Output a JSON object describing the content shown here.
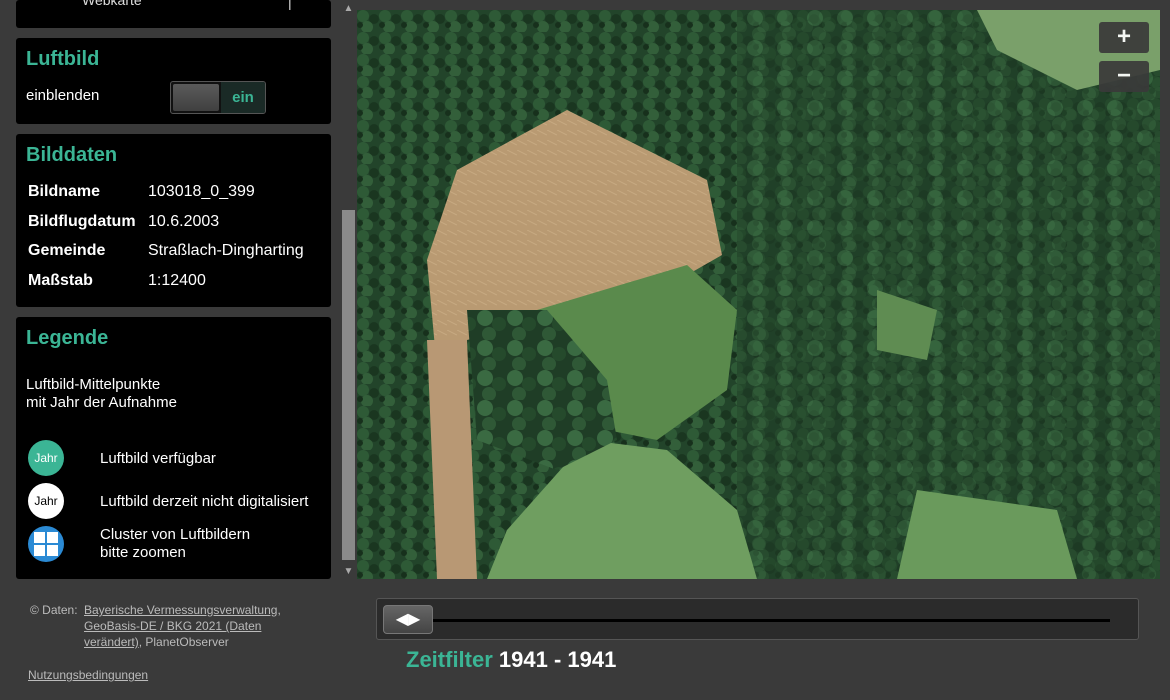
{
  "top_panel": {
    "label": "Webkarte",
    "mark": "|"
  },
  "luftbild": {
    "title": "Luftbild",
    "label": "einblenden",
    "toggle_state": "ein"
  },
  "bilddaten": {
    "title": "Bilddaten",
    "rows": [
      {
        "key": "Bildname",
        "value": "103018_0_399"
      },
      {
        "key": "Bildflugdatum",
        "value": "10.6.2003"
      },
      {
        "key": "Gemeinde",
        "value": "Straßlach-Dingharting"
      },
      {
        "key": "Maßstab",
        "value": "1:12400"
      }
    ]
  },
  "legende": {
    "title": "Legende",
    "intro_line1": "Luftbild-Mittelpunkte",
    "intro_line2": "mit Jahr der Aufnahme",
    "items": [
      {
        "symbol_text": "Jahr",
        "line1": "Luftbild verfügbar",
        "line2": ""
      },
      {
        "symbol_text": "Jahr",
        "line1": "Luftbild derzeit nicht digitalisiert",
        "line2": ""
      },
      {
        "symbol_text": "",
        "line1": "Cluster von Luftbildern",
        "line2": "bitte zoomen"
      }
    ]
  },
  "map": {
    "zoom_in": "+",
    "zoom_out": "−"
  },
  "footer": {
    "prefix": "© Daten:",
    "link1": "Bayerische Vermessungsverwaltung",
    "sep1": ",",
    "link2": "GeoBasis-DE / BKG 2021 (Daten verändert)",
    "suffix": ", PlanetObserver",
    "terms": "Nutzungsbedingungen"
  },
  "timefilter": {
    "label": "Zeitfilter",
    "range": "1941 - 1941",
    "handle_glyph": "◀▶"
  },
  "colors": {
    "accent": "#3bb595",
    "panel_bg": "#000000",
    "page_bg": "#3a3a3a"
  }
}
